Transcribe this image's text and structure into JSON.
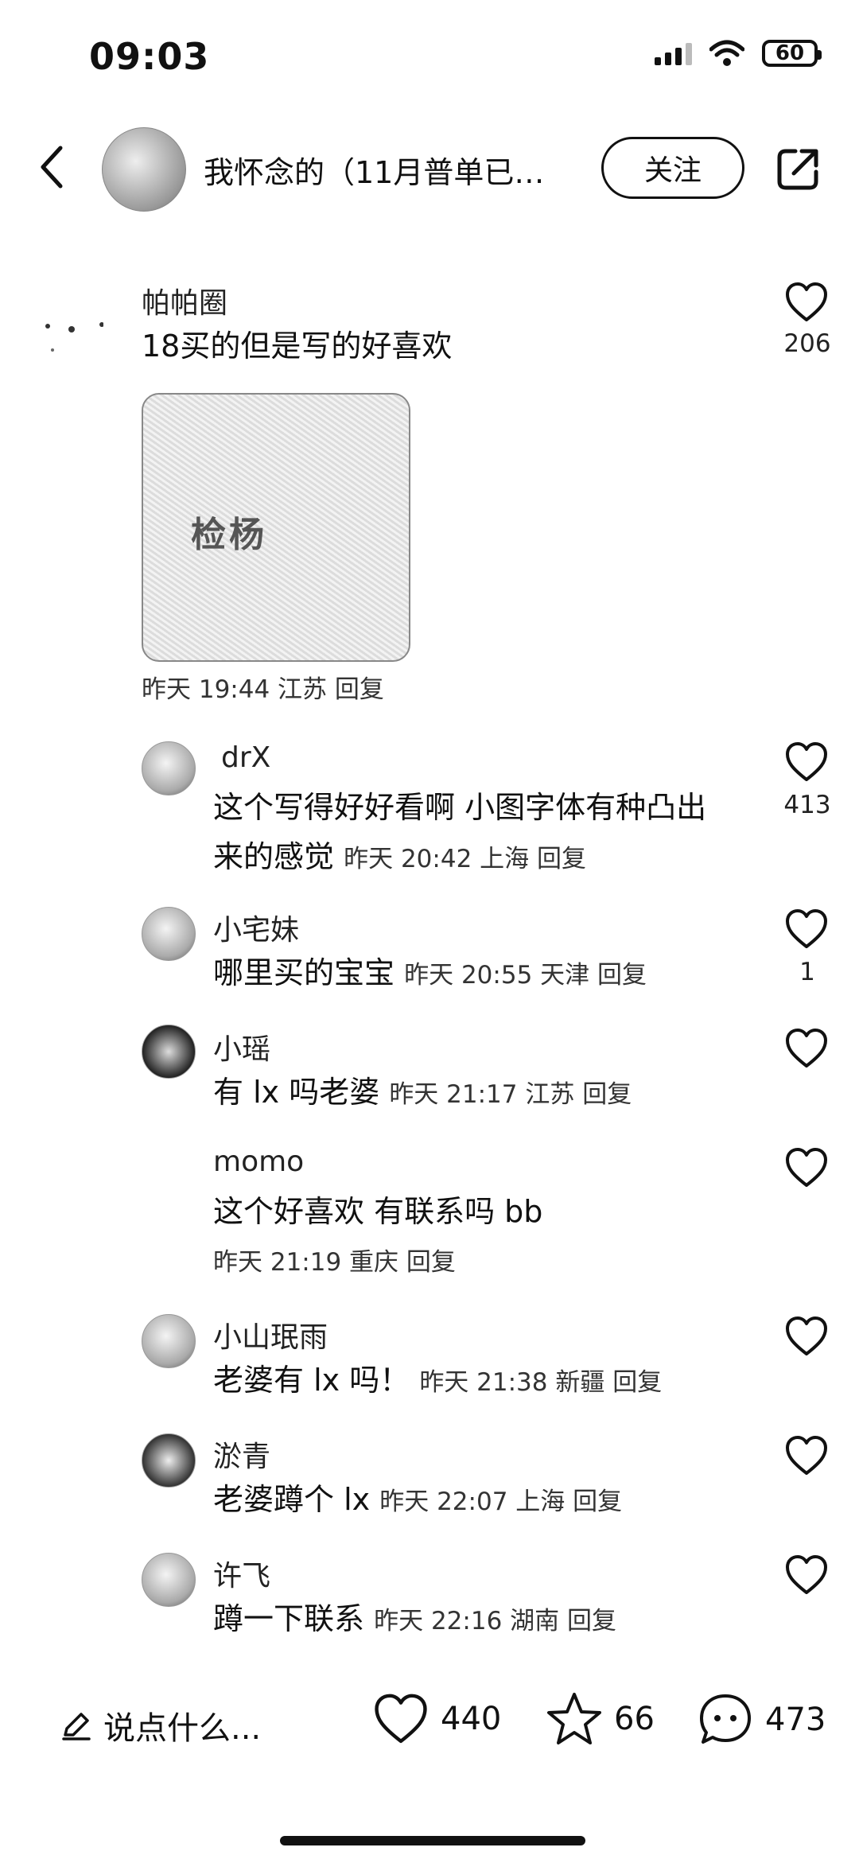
{
  "status_bar": {
    "time": "09:03",
    "battery": "60"
  },
  "header": {
    "title": "我怀念的（11月普单已…",
    "follow_label": "关注"
  },
  "main_comment": {
    "name": "帕帕圈",
    "text": "18买的但是写的好喜欢",
    "likes": "206",
    "image_text": "检杨",
    "meta": "昨天 19:44 江苏 回复"
  },
  "replies": [
    {
      "name": "drX",
      "text_line1": "这个写得好好看啊 小图字体有种凸出",
      "text_line2": "来的感觉",
      "meta": "昨天 20:42 上海 回复",
      "likes": "413"
    },
    {
      "name": "小宅妹",
      "text": "哪里买的宝宝",
      "meta": "昨天 20:55 天津 回复",
      "likes": "1"
    },
    {
      "name": "小瑶",
      "text": "有 lx 吗老婆",
      "meta": "昨天 21:17 江苏 回复",
      "likes": ""
    },
    {
      "name": "momo",
      "text": "这个好喜欢 有联系吗 bb",
      "meta": "昨天 21:19 重庆 回复",
      "likes": ""
    },
    {
      "name": "小山珉雨",
      "text": "老婆有 lx 吗！",
      "meta": "昨天 21:38 新疆 回复",
      "likes": ""
    },
    {
      "name": "淤青",
      "text": "老婆蹲个 lx",
      "meta": "昨天 22:07 上海 回复",
      "likes": ""
    },
    {
      "name": "许飞",
      "text": "蹲一下联系",
      "meta": "昨天 22:16 湖南 回复",
      "likes": ""
    }
  ],
  "bottom_bar": {
    "input_placeholder": "说点什么...",
    "likes": "440",
    "favorites": "66",
    "comments": "473"
  }
}
